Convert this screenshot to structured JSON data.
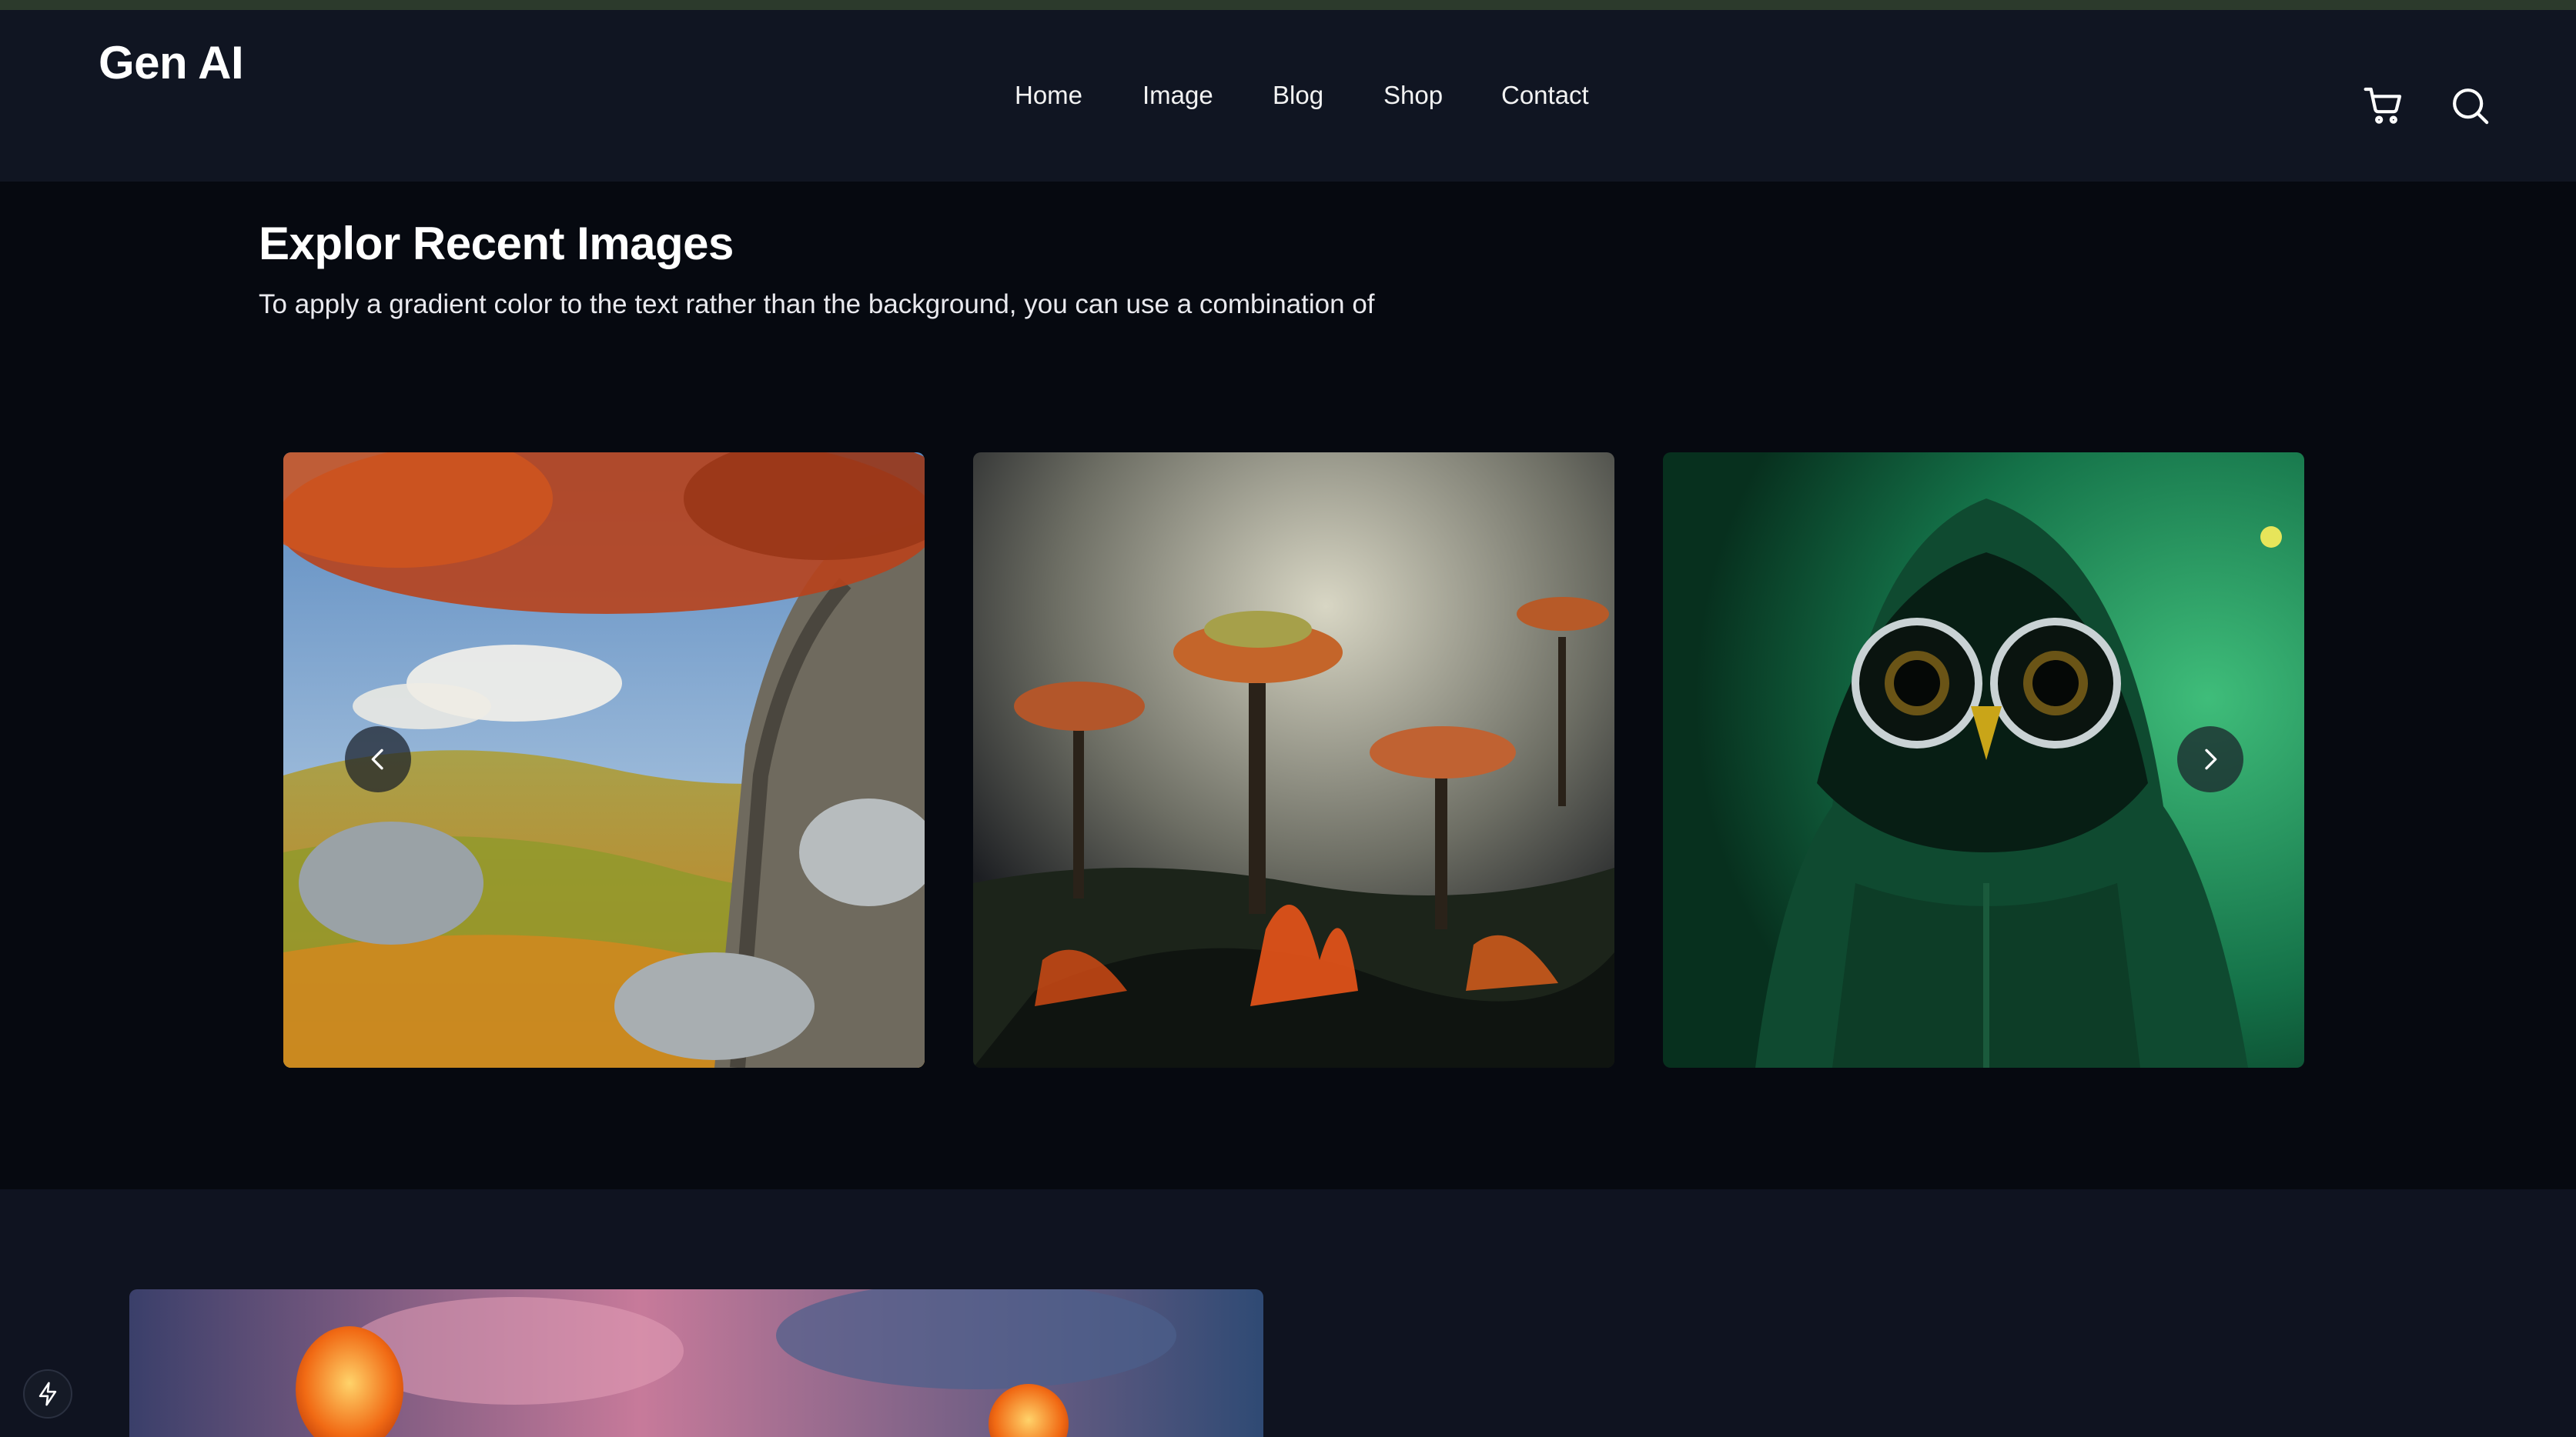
{
  "header": {
    "logo": "Gen AI",
    "nav": [
      {
        "label": "Home"
      },
      {
        "label": "Image"
      },
      {
        "label": "Blog"
      },
      {
        "label": "Shop"
      },
      {
        "label": "Contact"
      }
    ],
    "icons": [
      "cart-icon",
      "search-icon"
    ]
  },
  "gallery": {
    "title": "Explor Recent Images",
    "subtitle": "To apply a gradient color to the text rather than the background, you can use a combination of",
    "slides": [
      "landscape-tree-image",
      "burning-forest-image",
      "owl-hoodie-image"
    ]
  },
  "lower": {
    "banner": "lanterns-sky-image"
  },
  "fab": {
    "icon": "bolt-icon"
  }
}
